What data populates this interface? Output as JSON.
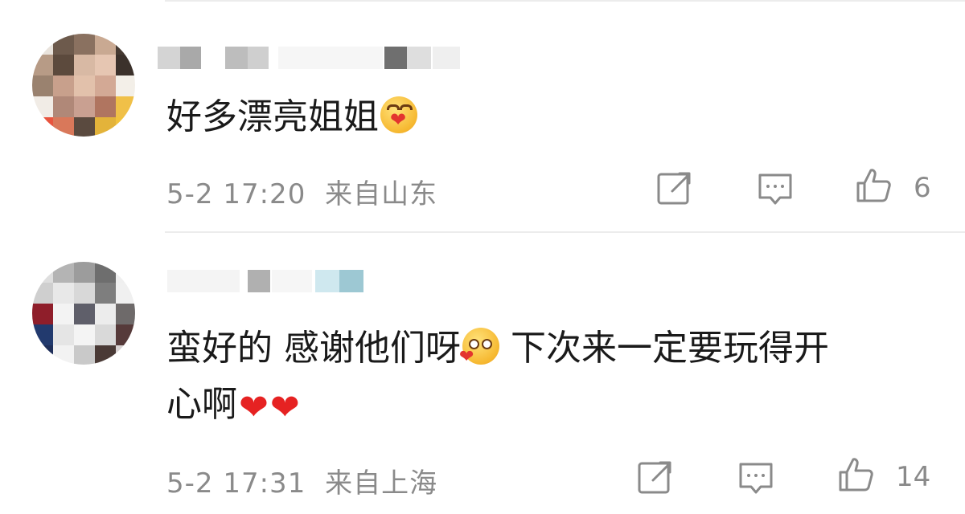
{
  "comments": [
    {
      "text": "好多漂亮姐姐",
      "time": "5-2 17:20",
      "location": "来自山东",
      "like_count": "6"
    },
    {
      "text_part1": "蛮好的 感谢他们呀",
      "text_part2": " 下次来一定要玩得开",
      "text_line2": "心啊",
      "time": "5-2 17:31",
      "location": "来自上海",
      "like_count": "14"
    }
  ],
  "colors": {
    "text": "#1a1a1a",
    "meta": "#8a8a8a",
    "icon": "#8a8a8a",
    "divider": "#ececec",
    "heart": "#e62222"
  },
  "icons": [
    "share-icon",
    "comment-icon",
    "like-icon"
  ]
}
